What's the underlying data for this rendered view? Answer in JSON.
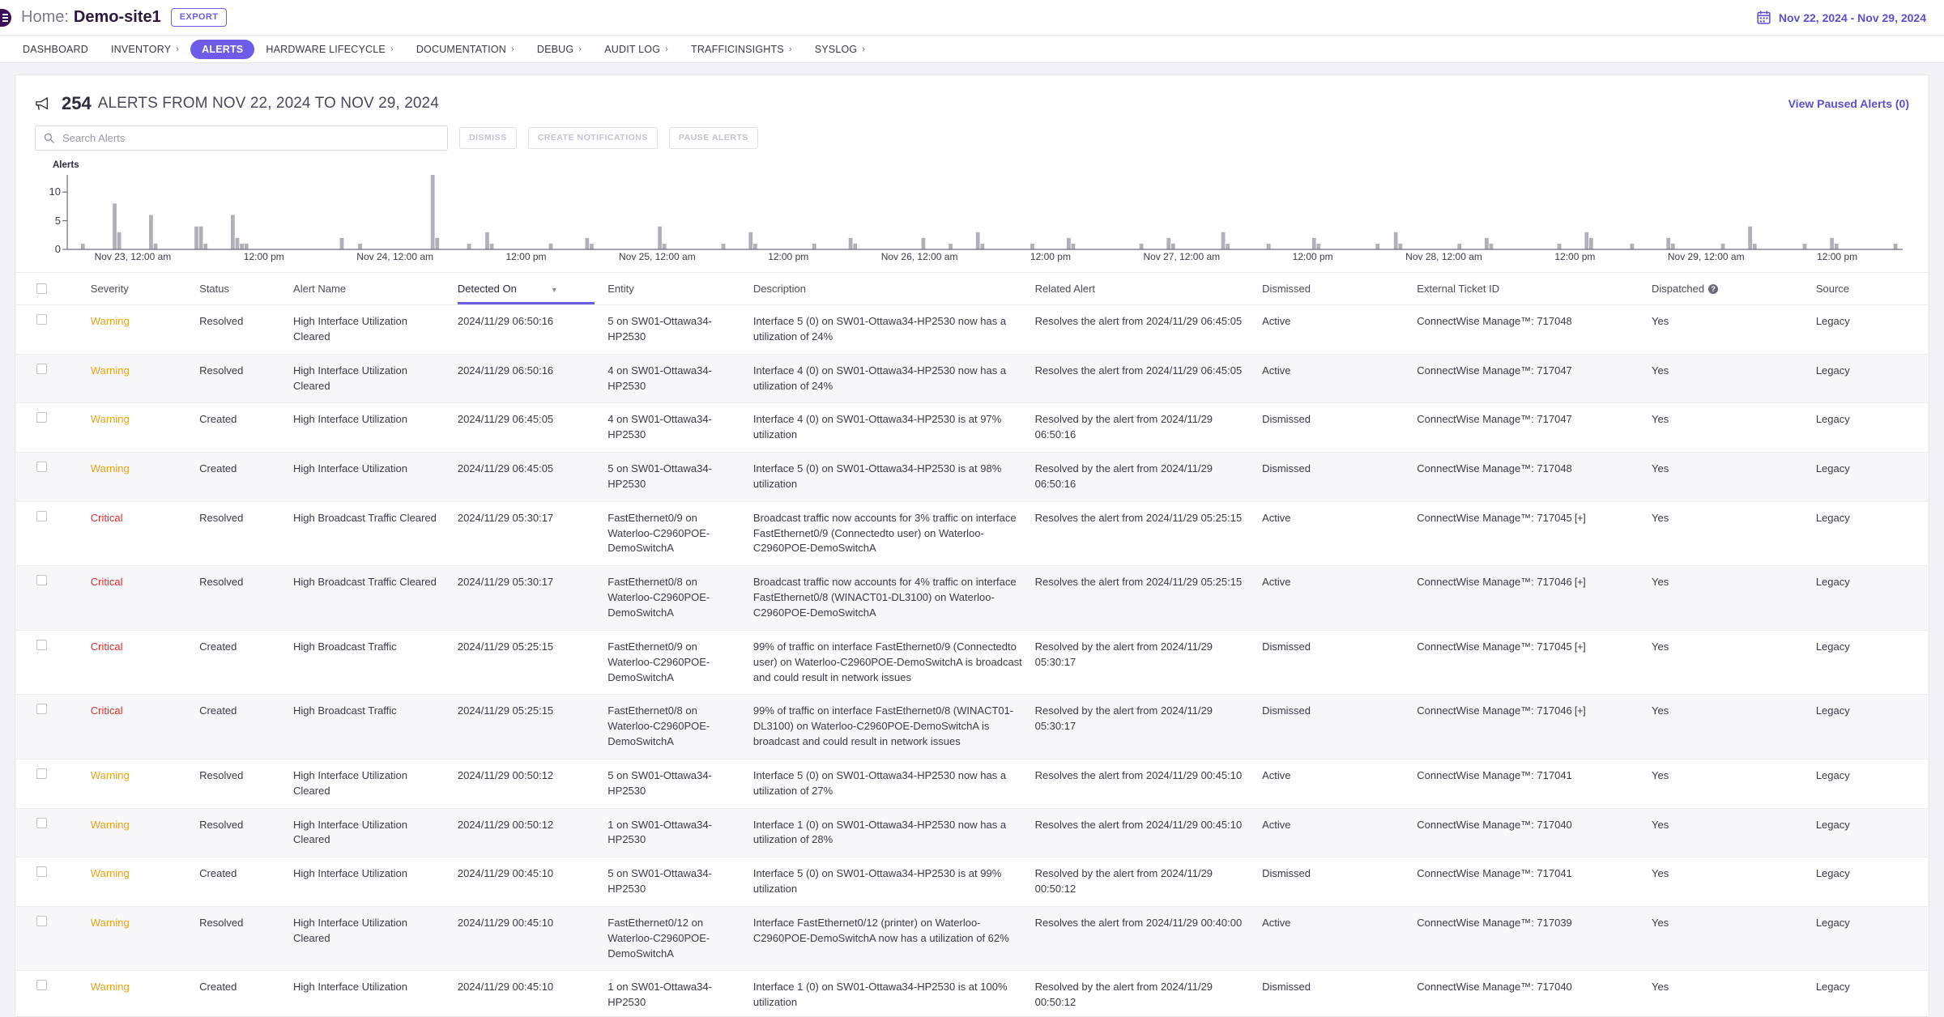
{
  "topbar": {
    "breadcrumb_home": "Home:",
    "breadcrumb_site": "Demo-site1",
    "export_label": "EXPORT",
    "date_range": "Nov 22, 2024 - Nov 29, 2024",
    "calendar_icon": "calendar-icon",
    "logo_icon": "brand-logo-icon"
  },
  "nav": {
    "items": [
      {
        "label": "DASHBOARD",
        "caret": "",
        "active": false
      },
      {
        "label": "INVENTORY",
        "caret": "›",
        "active": false
      },
      {
        "label": "ALERTS",
        "caret": "",
        "active": true
      },
      {
        "label": "HARDWARE LIFECYCLE",
        "caret": "›",
        "active": false
      },
      {
        "label": "DOCUMENTATION",
        "caret": "›",
        "active": false
      },
      {
        "label": "DEBUG",
        "caret": "›",
        "active": false
      },
      {
        "label": "AUDIT LOG",
        "caret": "›",
        "active": false
      },
      {
        "label": "TRAFFICINSIGHTS",
        "caret": "›",
        "active": false
      },
      {
        "label": "SYSLOG",
        "caret": "›",
        "active": false
      }
    ]
  },
  "header": {
    "icon": "megaphone-icon",
    "count": "254",
    "summary": "ALERTS FROM NOV 22, 2024 TO NOV 29, 2024",
    "view_paused": "View Paused Alerts (0)"
  },
  "toolbar": {
    "search_placeholder": "Search Alerts",
    "search_value": "",
    "search_icon": "search-icon",
    "dismiss_label": "DISMISS",
    "create_notifications_label": "CREATE NOTIFICATIONS",
    "pause_alerts_label": "PAUSE ALERTS"
  },
  "chart_data": {
    "type": "bar",
    "title": "Alerts",
    "xlabel": "",
    "ylabel": "Alerts",
    "ylim": [
      0,
      13
    ],
    "yticks": [
      0,
      5,
      10
    ],
    "grid": false,
    "legend": "none",
    "xticks": [
      "Nov 23, 12:00 am",
      "12:00 pm",
      "Nov 24, 12:00 am",
      "12:00 pm",
      "Nov 25, 12:00 am",
      "12:00 pm",
      "Nov 26, 12:00 am",
      "12:00 pm",
      "Nov 27, 12:00 am",
      "12:00 pm",
      "Nov 28, 12:00 am",
      "12:00 pm",
      "Nov 29, 12:00 am",
      "12:00 pm"
    ],
    "bar_color": "#b0b0b8",
    "values": [
      0,
      0,
      0,
      1,
      0,
      0,
      0,
      0,
      0,
      0,
      8,
      3,
      0,
      0,
      0,
      0,
      0,
      0,
      6,
      1,
      0,
      0,
      0,
      0,
      0,
      0,
      0,
      0,
      4,
      4,
      1,
      0,
      0,
      0,
      0,
      0,
      6,
      2,
      1,
      1,
      0,
      0,
      0,
      0,
      0,
      0,
      0,
      0,
      0,
      0,
      0,
      0,
      0,
      0,
      0,
      0,
      0,
      0,
      0,
      0,
      2,
      0,
      0,
      0,
      1,
      0,
      0,
      0,
      0,
      0,
      0,
      0,
      0,
      0,
      0,
      0,
      0,
      0,
      0,
      0,
      13,
      2,
      0,
      0,
      0,
      0,
      0,
      0,
      1,
      0,
      0,
      0,
      3,
      1,
      0,
      0,
      0,
      0,
      0,
      0,
      0,
      0,
      0,
      0,
      0,
      0,
      1,
      0,
      0,
      0,
      0,
      0,
      0,
      0,
      2,
      1,
      0,
      0,
      0,
      0,
      0,
      0,
      0,
      0,
      0,
      0,
      0,
      0,
      0,
      0,
      4,
      1,
      0,
      0,
      0,
      0,
      0,
      0,
      0,
      0,
      0,
      0,
      0,
      0,
      1,
      0,
      0,
      0,
      0,
      0,
      3,
      1,
      0,
      0,
      0,
      0,
      0,
      0,
      0,
      0,
      0,
      0,
      0,
      0,
      1,
      0,
      0,
      0,
      0,
      0,
      0,
      0,
      2,
      1,
      0,
      0,
      0,
      0,
      0,
      0,
      0,
      0,
      0,
      0,
      0,
      0,
      0,
      0,
      2,
      0,
      0,
      0,
      0,
      0,
      1,
      0,
      0,
      0,
      0,
      0,
      3,
      1,
      0,
      0,
      0,
      0,
      0,
      0,
      0,
      0,
      0,
      0,
      1,
      0,
      0,
      0,
      0,
      0,
      0,
      0,
      2,
      1,
      0,
      0,
      0,
      0,
      0,
      0,
      0,
      0,
      0,
      0,
      0,
      0,
      0,
      0,
      1,
      0,
      0,
      0,
      0,
      0,
      2,
      1,
      0,
      0,
      0,
      0,
      0,
      0,
      0,
      0,
      0,
      0,
      3,
      1,
      0,
      0,
      0,
      0,
      0,
      0,
      0,
      0,
      1,
      0,
      0,
      0,
      0,
      0,
      0,
      0,
      0,
      0,
      2,
      1,
      0,
      0,
      0,
      0,
      0,
      0,
      0,
      0,
      0,
      0,
      0,
      0,
      1,
      0,
      0,
      0,
      3,
      1,
      0,
      0,
      0,
      0,
      0,
      0,
      0,
      0,
      0,
      0,
      0,
      0,
      1,
      0,
      0,
      0,
      0,
      0,
      2,
      1,
      0,
      0,
      0,
      0,
      0,
      0,
      0,
      0,
      0,
      0,
      0,
      0,
      0,
      0,
      1,
      0,
      0,
      0,
      0,
      0,
      3,
      2,
      0,
      0,
      0,
      0,
      0,
      0,
      0,
      0,
      1,
      0,
      0,
      0,
      0,
      0,
      0,
      0,
      2,
      1,
      0,
      0,
      0,
      0,
      0,
      0,
      0,
      0,
      0,
      0,
      1,
      0,
      0,
      0,
      0,
      0,
      4,
      1,
      0,
      0,
      0,
      0,
      0,
      0,
      0,
      0,
      0,
      0,
      1,
      0,
      0,
      0,
      0,
      0,
      2,
      1,
      0,
      0,
      0,
      0,
      0,
      0,
      0,
      0,
      0,
      0,
      0,
      0,
      1,
      0
    ]
  },
  "table": {
    "columns": [
      {
        "key": "checkbox",
        "label": ""
      },
      {
        "key": "severity",
        "label": "Severity"
      },
      {
        "key": "status",
        "label": "Status"
      },
      {
        "key": "alert_name",
        "label": "Alert Name"
      },
      {
        "key": "detected_on",
        "label": "Detected On",
        "sorted": true,
        "sort_icon": "chevron-down-icon"
      },
      {
        "key": "entity",
        "label": "Entity"
      },
      {
        "key": "description",
        "label": "Description"
      },
      {
        "key": "related_alert",
        "label": "Related Alert"
      },
      {
        "key": "dismissed",
        "label": "Dismissed"
      },
      {
        "key": "external_ticket_id",
        "label": "External Ticket ID"
      },
      {
        "key": "dispatched",
        "label": "Dispatched",
        "help_icon": "help-icon"
      },
      {
        "key": "source",
        "label": "Source"
      }
    ],
    "rows": [
      {
        "severity": "Warning",
        "severity_level": "warning",
        "status": "Resolved",
        "alert_name": "High Interface Utilization Cleared",
        "detected_on": "2024/11/29 06:50:16",
        "entity": "5 on SW01-Ottawa34-HP2530",
        "description": "Interface 5 (0) on SW01-Ottawa34-HP2530 now has a utilization of 24%",
        "related_alert": "Resolves the alert from 2024/11/29 06:45:05",
        "dismissed": "Active",
        "external_ticket_id": "ConnectWise Manage™: 717048",
        "dispatched": "Yes",
        "source": "Legacy"
      },
      {
        "severity": "Warning",
        "severity_level": "warning",
        "status": "Resolved",
        "alert_name": "High Interface Utilization Cleared",
        "detected_on": "2024/11/29 06:50:16",
        "entity": "4 on SW01-Ottawa34-HP2530",
        "description": "Interface 4 (0) on SW01-Ottawa34-HP2530 now has a utilization of 24%",
        "related_alert": "Resolves the alert from 2024/11/29 06:45:05",
        "dismissed": "Active",
        "external_ticket_id": "ConnectWise Manage™: 717047",
        "dispatched": "Yes",
        "source": "Legacy"
      },
      {
        "severity": "Warning",
        "severity_level": "warning",
        "status": "Created",
        "alert_name": "High Interface Utilization",
        "detected_on": "2024/11/29 06:45:05",
        "entity": "4 on SW01-Ottawa34-HP2530",
        "description": "Interface 4 (0) on SW01-Ottawa34-HP2530 is at 97% utilization",
        "related_alert": "Resolved by the alert from 2024/11/29 06:50:16",
        "dismissed": "Dismissed",
        "external_ticket_id": "ConnectWise Manage™: 717047",
        "dispatched": "Yes",
        "source": "Legacy"
      },
      {
        "severity": "Warning",
        "severity_level": "warning",
        "status": "Created",
        "alert_name": "High Interface Utilization",
        "detected_on": "2024/11/29 06:45:05",
        "entity": "5 on SW01-Ottawa34-HP2530",
        "description": "Interface 5 (0) on SW01-Ottawa34-HP2530 is at 98% utilization",
        "related_alert": "Resolved by the alert from 2024/11/29 06:50:16",
        "dismissed": "Dismissed",
        "external_ticket_id": "ConnectWise Manage™: 717048",
        "dispatched": "Yes",
        "source": "Legacy"
      },
      {
        "severity": "Critical",
        "severity_level": "critical",
        "status": "Resolved",
        "alert_name": "High Broadcast Traffic Cleared",
        "detected_on": "2024/11/29 05:30:17",
        "entity": "FastEthernet0/9 on Waterloo-C2960POE-DemoSwitchA",
        "description": "Broadcast traffic now accounts for 3% traffic on interface FastEthernet0/9 (Connectedto user) on Waterloo-C2960POE-DemoSwitchA",
        "related_alert": "Resolves the alert from 2024/11/29 05:25:15",
        "dismissed": "Active",
        "external_ticket_id": "ConnectWise Manage™: 717045",
        "ticket_expand": "[+]",
        "dispatched": "Yes",
        "source": "Legacy"
      },
      {
        "severity": "Critical",
        "severity_level": "critical",
        "status": "Resolved",
        "alert_name": "High Broadcast Traffic Cleared",
        "detected_on": "2024/11/29 05:30:17",
        "entity": "FastEthernet0/8 on Waterloo-C2960POE-DemoSwitchA",
        "description": "Broadcast traffic now accounts for 4% traffic on interface FastEthernet0/8 (WINACT01-DL3100) on Waterloo-C2960POE-DemoSwitchA",
        "related_alert": "Resolves the alert from 2024/11/29 05:25:15",
        "dismissed": "Active",
        "external_ticket_id": "ConnectWise Manage™: 717046",
        "ticket_expand": "[+]",
        "dispatched": "Yes",
        "source": "Legacy"
      },
      {
        "severity": "Critical",
        "severity_level": "critical",
        "status": "Created",
        "alert_name": "High Broadcast Traffic",
        "detected_on": "2024/11/29 05:25:15",
        "entity": "FastEthernet0/9 on Waterloo-C2960POE-DemoSwitchA",
        "description": "99% of traffic on interface FastEthernet0/9 (Connectedto user) on Waterloo-C2960POE-DemoSwitchA is broadcast and could result in network issues",
        "related_alert": "Resolved by the alert from 2024/11/29 05:30:17",
        "dismissed": "Dismissed",
        "external_ticket_id": "ConnectWise Manage™: 717045",
        "ticket_expand": "[+]",
        "dispatched": "Yes",
        "source": "Legacy"
      },
      {
        "severity": "Critical",
        "severity_level": "critical",
        "status": "Created",
        "alert_name": "High Broadcast Traffic",
        "detected_on": "2024/11/29 05:25:15",
        "entity": "FastEthernet0/8 on Waterloo-C2960POE-DemoSwitchA",
        "description": "99% of traffic on interface FastEthernet0/8 (WINACT01-DL3100) on Waterloo-C2960POE-DemoSwitchA is broadcast and could result in network issues",
        "related_alert": "Resolved by the alert from 2024/11/29 05:30:17",
        "dismissed": "Dismissed",
        "external_ticket_id": "ConnectWise Manage™: 717046",
        "ticket_expand": "[+]",
        "dispatched": "Yes",
        "source": "Legacy"
      },
      {
        "severity": "Warning",
        "severity_level": "warning",
        "status": "Resolved",
        "alert_name": "High Interface Utilization Cleared",
        "detected_on": "2024/11/29 00:50:12",
        "entity": "5 on SW01-Ottawa34-HP2530",
        "description": "Interface 5 (0) on SW01-Ottawa34-HP2530 now has a utilization of 27%",
        "related_alert": "Resolves the alert from 2024/11/29 00:45:10",
        "dismissed": "Active",
        "external_ticket_id": "ConnectWise Manage™: 717041",
        "dispatched": "Yes",
        "source": "Legacy"
      },
      {
        "severity": "Warning",
        "severity_level": "warning",
        "status": "Resolved",
        "alert_name": "High Interface Utilization Cleared",
        "detected_on": "2024/11/29 00:50:12",
        "entity": "1 on SW01-Ottawa34-HP2530",
        "description": "Interface 1 (0) on SW01-Ottawa34-HP2530 now has a utilization of 28%",
        "related_alert": "Resolves the alert from 2024/11/29 00:45:10",
        "dismissed": "Active",
        "external_ticket_id": "ConnectWise Manage™: 717040",
        "dispatched": "Yes",
        "source": "Legacy"
      },
      {
        "severity": "Warning",
        "severity_level": "warning",
        "status": "Created",
        "alert_name": "High Interface Utilization",
        "detected_on": "2024/11/29 00:45:10",
        "entity": "5 on SW01-Ottawa34-HP2530",
        "description": "Interface 5 (0) on SW01-Ottawa34-HP2530 is at 99% utilization",
        "related_alert": "Resolved by the alert from 2024/11/29 00:50:12",
        "dismissed": "Dismissed",
        "external_ticket_id": "ConnectWise Manage™: 717041",
        "dispatched": "Yes",
        "source": "Legacy"
      },
      {
        "severity": "Warning",
        "severity_level": "warning",
        "status": "Resolved",
        "alert_name": "High Interface Utilization Cleared",
        "detected_on": "2024/11/29 00:45:10",
        "entity": "FastEthernet0/12 on Waterloo-C2960POE-DemoSwitchA",
        "description": "Interface FastEthernet0/12 (printer) on Waterloo-C2960POE-DemoSwitchA now has a utilization of 62%",
        "related_alert": "Resolves the alert from 2024/11/29 00:40:00",
        "dismissed": "Active",
        "external_ticket_id": "ConnectWise Manage™: 717039",
        "dispatched": "Yes",
        "source": "Legacy"
      },
      {
        "severity": "Warning",
        "severity_level": "warning",
        "status": "Created",
        "alert_name": "High Interface Utilization",
        "detected_on": "2024/11/29 00:45:10",
        "entity": "1 on SW01-Ottawa34-HP2530",
        "description": "Interface 1 (0) on SW01-Ottawa34-HP2530 is at 100% utilization",
        "related_alert": "Resolved by the alert from 2024/11/29 00:50:12",
        "dismissed": "Dismissed",
        "external_ticket_id": "ConnectWise Manage™: 717040",
        "dispatched": "Yes",
        "source": "Legacy"
      }
    ]
  }
}
